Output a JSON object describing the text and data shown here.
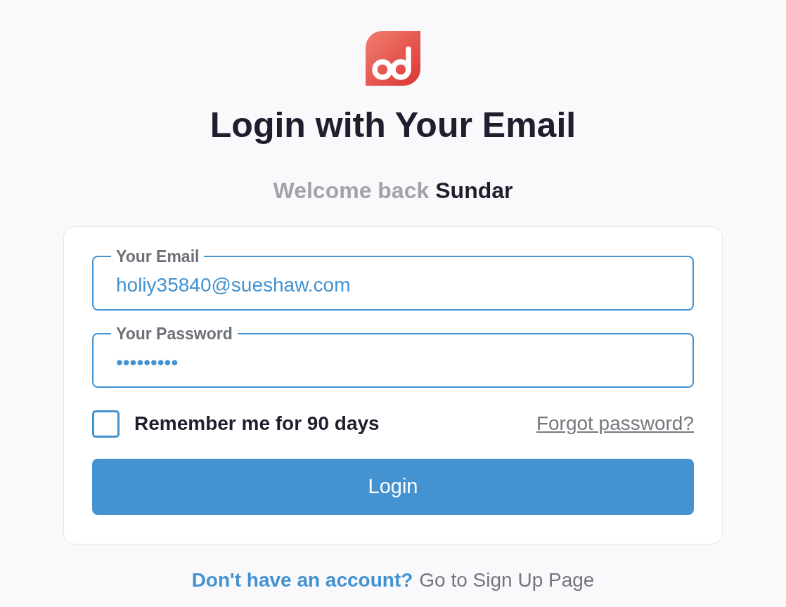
{
  "title": "Login with Your Email",
  "greeting": {
    "text": "Welcome back",
    "name": "Sundar"
  },
  "form": {
    "fields": [
      {
        "label": "Your Email",
        "value": "holiy35840@sueshaw.com"
      },
      {
        "label": "Your Password",
        "value": "•••••••••"
      }
    ],
    "remember": {
      "label": "Remember me for 90 days",
      "checked": false
    },
    "forgot_link": "Forgot password?",
    "submit": "Login"
  },
  "footer": {
    "prompt": "Don't have an account?",
    "link": "Go to Sign Up Page"
  }
}
